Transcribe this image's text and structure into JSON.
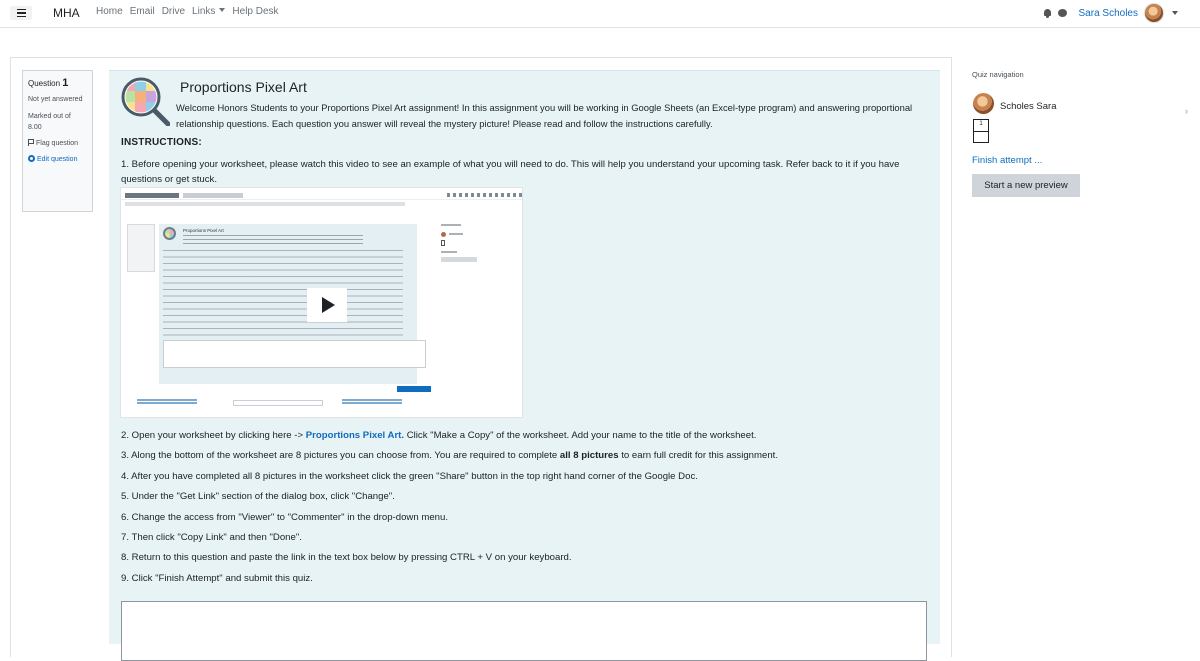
{
  "navbar": {
    "brand": "MHA",
    "links": [
      "Home",
      "Email",
      "Drive",
      "Links",
      "Help Desk"
    ],
    "user_name": "Sara Scholes"
  },
  "question_info": {
    "label": "Question",
    "number": "1",
    "status": "Not yet answered",
    "marks_label": "Marked out of",
    "marks": "8.00",
    "flag_label": "Flag question",
    "edit_label": "Edit question"
  },
  "content": {
    "title": "Proportions Pixel Art",
    "intro": "Welcome Honors Students to your Proportions Pixel Art assignment! In this assignment you will be working in Google Sheets (an Excel-type program) and answering proportional relationship questions. Each question you answer will reveal the mystery picture! Please read and follow the instructions carefully.",
    "instructions_heading": "INSTRUCTIONS:",
    "step1": "1. Before opening your worksheet, please watch this video to see an example of what you will need to do. This will help you understand your upcoming task. Refer back to it if you have questions or get stuck.",
    "step2_prefix": "2. Open your worksheet by clicking here -> ",
    "step2_link": "Proportions Pixel Art.",
    "step2_suffix": " Click \"Make a Copy\" of the worksheet. Add your name to the title of the worksheet.",
    "step3_prefix": "3. Along the bottom of the worksheet are 8 pictures you can choose from. You are required to complete ",
    "step3_bold": "all 8 pictures",
    "step3_suffix": " to earn full credit for this assignment.",
    "step4": "4. After you have completed all 8 pictures in the worksheet click the green \"Share\" button in the top right hand corner of the Google Doc.",
    "step5": "5. Under the \"Get Link\" section of the dialog box, click \"Change\".",
    "step6": "6. Change the access from \"Viewer\" to \"Commenter\" in the drop-down menu.",
    "step7": "7. Then click \"Copy Link\" and then \"Done\".",
    "step8": "8. Return to this question and paste the link in the text box below by pressing CTRL + V on your keyboard.",
    "step9": "9. Click \"Finish Attempt\" and submit this quiz.",
    "video_title": "Proportions Pixel Art"
  },
  "quiz_nav": {
    "title": "Quiz navigation",
    "user": "Scholes Sara",
    "question_number": "1",
    "finish_link": "Finish attempt ...",
    "preview_button": "Start a new preview"
  },
  "colors": {
    "accent": "#0f6cbf",
    "content_bg": "#e7f3f5",
    "text": "#1d2125"
  }
}
